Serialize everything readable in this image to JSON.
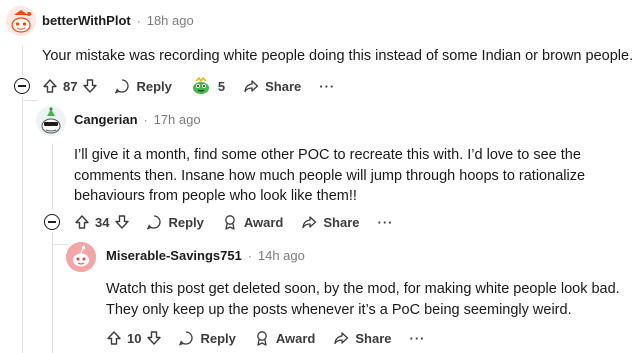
{
  "comments": [
    {
      "username": "betterWithPlot",
      "separator": "·",
      "time": "18h ago",
      "body": [
        "Your mistake was recording white people doing this instead of some Indian or brown people."
      ],
      "votes": "87",
      "reply_label": "Reply",
      "award_count": "5",
      "share_label": "Share",
      "more_label": "···"
    },
    {
      "username": "Cangerian",
      "separator": "·",
      "time": "17h ago",
      "body": [
        "I’ll give it a month, find some other POC to recreate this with. I’d love to see the",
        "comments then. Insane how much people will jump through hoops to rationalize",
        "behaviours from people who look like them!!"
      ],
      "votes": "34",
      "reply_label": "Reply",
      "award_label": "Award",
      "share_label": "Share",
      "more_label": "···"
    },
    {
      "username": "Miserable-Savings751",
      "separator": "·",
      "time": "14h ago",
      "body": [
        "Watch this post get deleted soon, by the mod, for making white people look bad.",
        "They only keep up the posts whenever it’s a PoC being seemingly weird."
      ],
      "votes": "10",
      "reply_label": "Reply",
      "award_label": "Award",
      "share_label": "Share",
      "more_label": "···"
    }
  ],
  "colors": {
    "award_green": "#46b84a",
    "avatar_red": "#ff4500",
    "avatar_pink": "#f4a6a6"
  }
}
